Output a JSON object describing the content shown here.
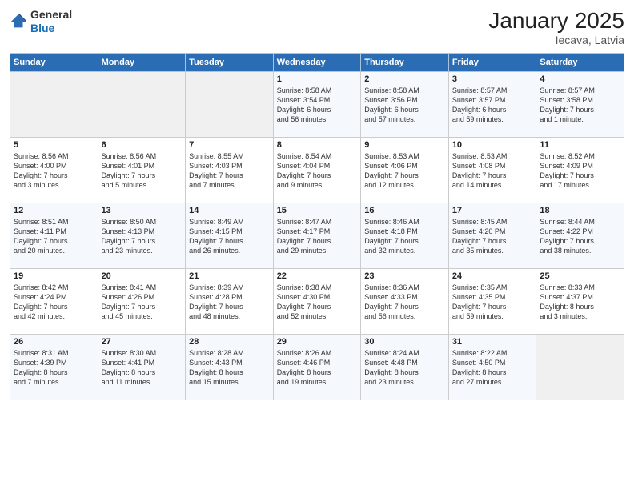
{
  "header": {
    "logo_general": "General",
    "logo_blue": "Blue",
    "month_title": "January 2025",
    "location": "Iecava, Latvia"
  },
  "days_of_week": [
    "Sunday",
    "Monday",
    "Tuesday",
    "Wednesday",
    "Thursday",
    "Friday",
    "Saturday"
  ],
  "weeks": [
    [
      {
        "day": "",
        "data": ""
      },
      {
        "day": "",
        "data": ""
      },
      {
        "day": "",
        "data": ""
      },
      {
        "day": "1",
        "data": "Sunrise: 8:58 AM\nSunset: 3:54 PM\nDaylight: 6 hours\nand 56 minutes."
      },
      {
        "day": "2",
        "data": "Sunrise: 8:58 AM\nSunset: 3:56 PM\nDaylight: 6 hours\nand 57 minutes."
      },
      {
        "day": "3",
        "data": "Sunrise: 8:57 AM\nSunset: 3:57 PM\nDaylight: 6 hours\nand 59 minutes."
      },
      {
        "day": "4",
        "data": "Sunrise: 8:57 AM\nSunset: 3:58 PM\nDaylight: 7 hours\nand 1 minute."
      }
    ],
    [
      {
        "day": "5",
        "data": "Sunrise: 8:56 AM\nSunset: 4:00 PM\nDaylight: 7 hours\nand 3 minutes."
      },
      {
        "day": "6",
        "data": "Sunrise: 8:56 AM\nSunset: 4:01 PM\nDaylight: 7 hours\nand 5 minutes."
      },
      {
        "day": "7",
        "data": "Sunrise: 8:55 AM\nSunset: 4:03 PM\nDaylight: 7 hours\nand 7 minutes."
      },
      {
        "day": "8",
        "data": "Sunrise: 8:54 AM\nSunset: 4:04 PM\nDaylight: 7 hours\nand 9 minutes."
      },
      {
        "day": "9",
        "data": "Sunrise: 8:53 AM\nSunset: 4:06 PM\nDaylight: 7 hours\nand 12 minutes."
      },
      {
        "day": "10",
        "data": "Sunrise: 8:53 AM\nSunset: 4:08 PM\nDaylight: 7 hours\nand 14 minutes."
      },
      {
        "day": "11",
        "data": "Sunrise: 8:52 AM\nSunset: 4:09 PM\nDaylight: 7 hours\nand 17 minutes."
      }
    ],
    [
      {
        "day": "12",
        "data": "Sunrise: 8:51 AM\nSunset: 4:11 PM\nDaylight: 7 hours\nand 20 minutes."
      },
      {
        "day": "13",
        "data": "Sunrise: 8:50 AM\nSunset: 4:13 PM\nDaylight: 7 hours\nand 23 minutes."
      },
      {
        "day": "14",
        "data": "Sunrise: 8:49 AM\nSunset: 4:15 PM\nDaylight: 7 hours\nand 26 minutes."
      },
      {
        "day": "15",
        "data": "Sunrise: 8:47 AM\nSunset: 4:17 PM\nDaylight: 7 hours\nand 29 minutes."
      },
      {
        "day": "16",
        "data": "Sunrise: 8:46 AM\nSunset: 4:18 PM\nDaylight: 7 hours\nand 32 minutes."
      },
      {
        "day": "17",
        "data": "Sunrise: 8:45 AM\nSunset: 4:20 PM\nDaylight: 7 hours\nand 35 minutes."
      },
      {
        "day": "18",
        "data": "Sunrise: 8:44 AM\nSunset: 4:22 PM\nDaylight: 7 hours\nand 38 minutes."
      }
    ],
    [
      {
        "day": "19",
        "data": "Sunrise: 8:42 AM\nSunset: 4:24 PM\nDaylight: 7 hours\nand 42 minutes."
      },
      {
        "day": "20",
        "data": "Sunrise: 8:41 AM\nSunset: 4:26 PM\nDaylight: 7 hours\nand 45 minutes."
      },
      {
        "day": "21",
        "data": "Sunrise: 8:39 AM\nSunset: 4:28 PM\nDaylight: 7 hours\nand 48 minutes."
      },
      {
        "day": "22",
        "data": "Sunrise: 8:38 AM\nSunset: 4:30 PM\nDaylight: 7 hours\nand 52 minutes."
      },
      {
        "day": "23",
        "data": "Sunrise: 8:36 AM\nSunset: 4:33 PM\nDaylight: 7 hours\nand 56 minutes."
      },
      {
        "day": "24",
        "data": "Sunrise: 8:35 AM\nSunset: 4:35 PM\nDaylight: 7 hours\nand 59 minutes."
      },
      {
        "day": "25",
        "data": "Sunrise: 8:33 AM\nSunset: 4:37 PM\nDaylight: 8 hours\nand 3 minutes."
      }
    ],
    [
      {
        "day": "26",
        "data": "Sunrise: 8:31 AM\nSunset: 4:39 PM\nDaylight: 8 hours\nand 7 minutes."
      },
      {
        "day": "27",
        "data": "Sunrise: 8:30 AM\nSunset: 4:41 PM\nDaylight: 8 hours\nand 11 minutes."
      },
      {
        "day": "28",
        "data": "Sunrise: 8:28 AM\nSunset: 4:43 PM\nDaylight: 8 hours\nand 15 minutes."
      },
      {
        "day": "29",
        "data": "Sunrise: 8:26 AM\nSunset: 4:46 PM\nDaylight: 8 hours\nand 19 minutes."
      },
      {
        "day": "30",
        "data": "Sunrise: 8:24 AM\nSunset: 4:48 PM\nDaylight: 8 hours\nand 23 minutes."
      },
      {
        "day": "31",
        "data": "Sunrise: 8:22 AM\nSunset: 4:50 PM\nDaylight: 8 hours\nand 27 minutes."
      },
      {
        "day": "",
        "data": ""
      }
    ]
  ]
}
